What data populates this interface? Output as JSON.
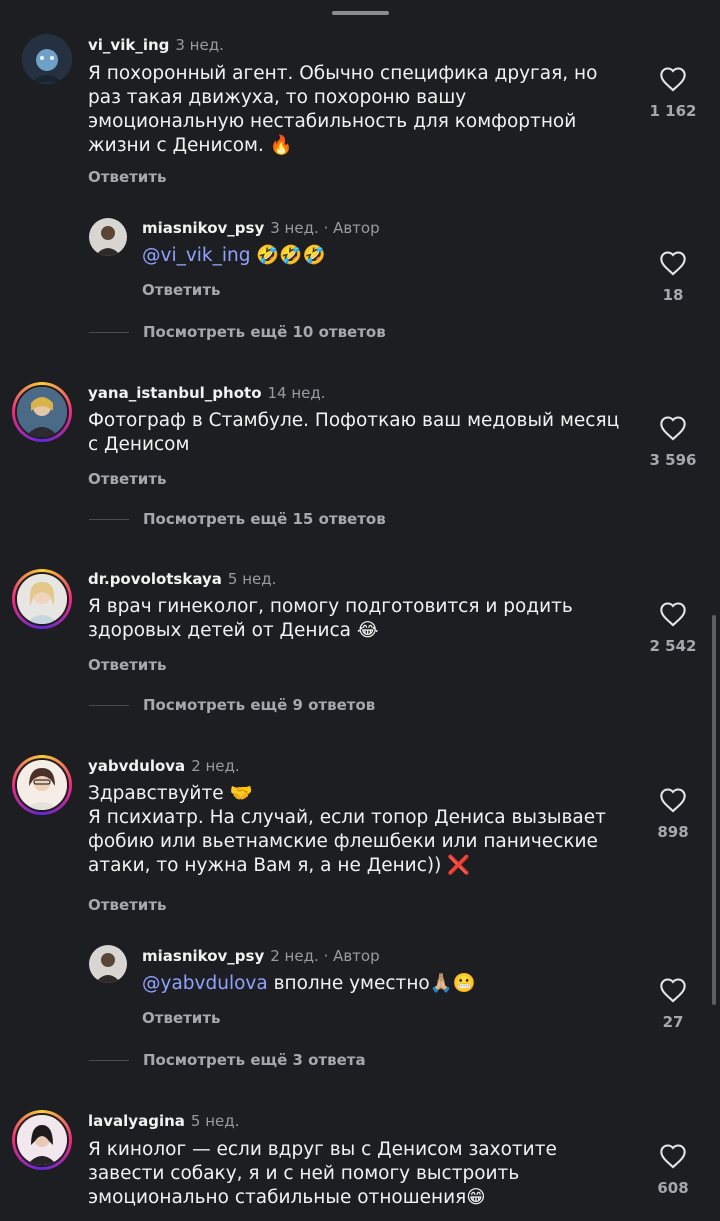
{
  "reply_label": "Ответить",
  "comments": [
    {
      "user": "vi_vik_ing",
      "time": "3 нед.",
      "text": "Я похоронный агент. Обычно специфика другая, но раз такая движуха, то похороню вашу эмоциональную нестабильность для комфортной жизни с Денисом. 🔥",
      "likes": "1 162",
      "reply": {
        "user": "miasnikov_psy",
        "time": "3 нед.",
        "author": "· Автор",
        "mention": "@vi_vik_ing",
        "text": " 🤣🤣🤣",
        "likes": "18"
      },
      "more": "Посмотреть ещё 10 ответов"
    },
    {
      "user": "yana_istanbul_photo",
      "time": "14 нед.",
      "text": "Фотограф в Стамбуле. Пофоткаю ваш медовый месяц с Денисом",
      "likes": "3 596",
      "more": "Посмотреть ещё 15 ответов"
    },
    {
      "user": "dr.povolotskaya",
      "time": "5 нед.",
      "text": "Я врач гинеколог, помогу подготовится  и родить здоровых детей от Дениса 😂",
      "likes": "2 542",
      "more": "Посмотреть ещё 9 ответов"
    },
    {
      "user": "yabvdulova",
      "time": "2 нед.",
      "text": "Здравствуйте 🤝\nЯ психиатр. На случай, если топор Дениса вызывает фобию или вьетнамские флешбеки или панические атаки, то нужна Вам я, а не Денис)) ❌",
      "likes": "898",
      "reply": {
        "user": "miasnikov_psy",
        "time": "2 нед.",
        "author": "· Автор",
        "mention": "@yabvdulova",
        "text": " вполне уместно🙏🏼😬",
        "likes": "27"
      },
      "more": "Посмотреть ещё 3 ответа"
    },
    {
      "user": "lavalyagina",
      "time": "5 нед.",
      "text": "Я кинолог — если вдруг вы с Денисом захотите завести собаку, я и с ней помогу выстроить эмоционально стабильные отношения😁",
      "likes": "608"
    }
  ]
}
